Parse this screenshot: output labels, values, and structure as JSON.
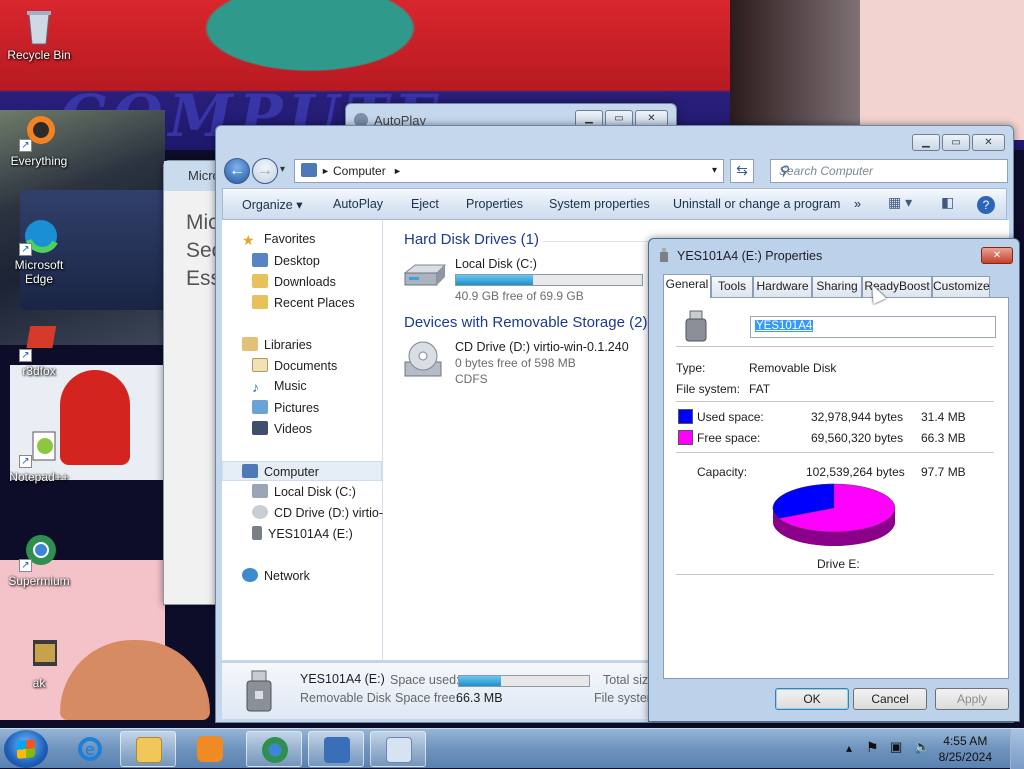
{
  "desktop": {
    "wallpaper_text": "COMPUTE",
    "icons": [
      {
        "label": "Recycle Bin",
        "icon": "recycle-bin-icon"
      },
      {
        "label": "Everything",
        "icon": "everything-search-icon"
      },
      {
        "label": "Microsoft Edge",
        "icon": "edge-browser-icon"
      },
      {
        "label": "r3dfox",
        "icon": "r3dfox-browser-icon"
      },
      {
        "label": "Notepad++",
        "icon": "notepad-plus-plus-icon"
      },
      {
        "label": "Supermium",
        "icon": "supermium-browser-icon"
      },
      {
        "label": "ak",
        "icon": "folder-icon"
      }
    ]
  },
  "autoplay_window": {
    "title": "AutoPlay"
  },
  "background_window": {
    "title": "Micro",
    "text_lines": [
      "Mic",
      "Sec",
      "Ess"
    ]
  },
  "explorer": {
    "address": {
      "root_icon": "computer-icon",
      "path": "Computer"
    },
    "search_placeholder": "Search Computer",
    "commands": [
      "Organize",
      "AutoPlay",
      "Eject",
      "Properties",
      "System properties",
      "Uninstall or change a program",
      "»"
    ],
    "nav": {
      "favorites": {
        "label": "Favorites",
        "items": [
          "Desktop",
          "Downloads",
          "Recent Places"
        ]
      },
      "libraries": {
        "label": "Libraries",
        "items": [
          "Documents",
          "Music",
          "Pictures",
          "Videos"
        ]
      },
      "computer": {
        "label": "Computer",
        "items": [
          "Local Disk (C:)",
          "CD Drive (D:) virtio-w",
          "YES101A4 (E:)"
        ]
      },
      "network": {
        "label": "Network"
      }
    },
    "groups": {
      "hdd": {
        "header": "Hard Disk Drives (1)",
        "drives": [
          {
            "name": "Local Disk (C:)",
            "free": "40.9 GB free of 69.9 GB",
            "used_fraction": 0.415
          }
        ]
      },
      "removable": {
        "header": "Devices with Removable Storage (2)",
        "drives": [
          {
            "name": "CD Drive (D:) virtio-win-0.1.240",
            "free": "0 bytes free of 598 MB",
            "fs": "CDFS"
          }
        ]
      }
    },
    "details": {
      "name": "YES101A4 (E:)",
      "type": "Removable Disk",
      "space_used_label": "Space used:",
      "space_free_label": "Space free:",
      "space_free_value": "66.3 MB",
      "used_fraction": 0.32,
      "total_label": "Total siz",
      "fs_label": "File system"
    }
  },
  "properties": {
    "title": "YES101A4 (E:) Properties",
    "tabs": [
      "General",
      "Tools",
      "Hardware",
      "Sharing",
      "ReadyBoost",
      "Customize"
    ],
    "active_tab": "General",
    "name_value": "YES101A4",
    "type_label": "Type:",
    "type_value": "Removable Disk",
    "fs_label": "File system:",
    "fs_value": "FAT",
    "used": {
      "label": "Used space:",
      "bytes": "32,978,944 bytes",
      "short": "31.4 MB",
      "color": "#0000ff"
    },
    "free": {
      "label": "Free space:",
      "bytes": "69,560,320 bytes",
      "short": "66.3 MB",
      "color": "#ff00ff"
    },
    "capacity": {
      "label": "Capacity:",
      "bytes": "102,539,264 bytes",
      "short": "97.7 MB"
    },
    "used_fraction": 0.3216,
    "drive_label": "Drive E:",
    "buttons": {
      "ok": "OK",
      "cancel": "Cancel",
      "apply": "Apply"
    }
  },
  "taskbar": {
    "items": [
      {
        "name": "internet-explorer",
        "open": false
      },
      {
        "name": "windows-explorer",
        "open": true
      },
      {
        "name": "media-player",
        "open": false
      },
      {
        "name": "browser-globe",
        "open": true
      },
      {
        "name": "installer",
        "open": true
      },
      {
        "name": "control-panel",
        "open": true
      }
    ],
    "clock_time": "4:55 AM",
    "clock_date": "8/25/2024"
  }
}
